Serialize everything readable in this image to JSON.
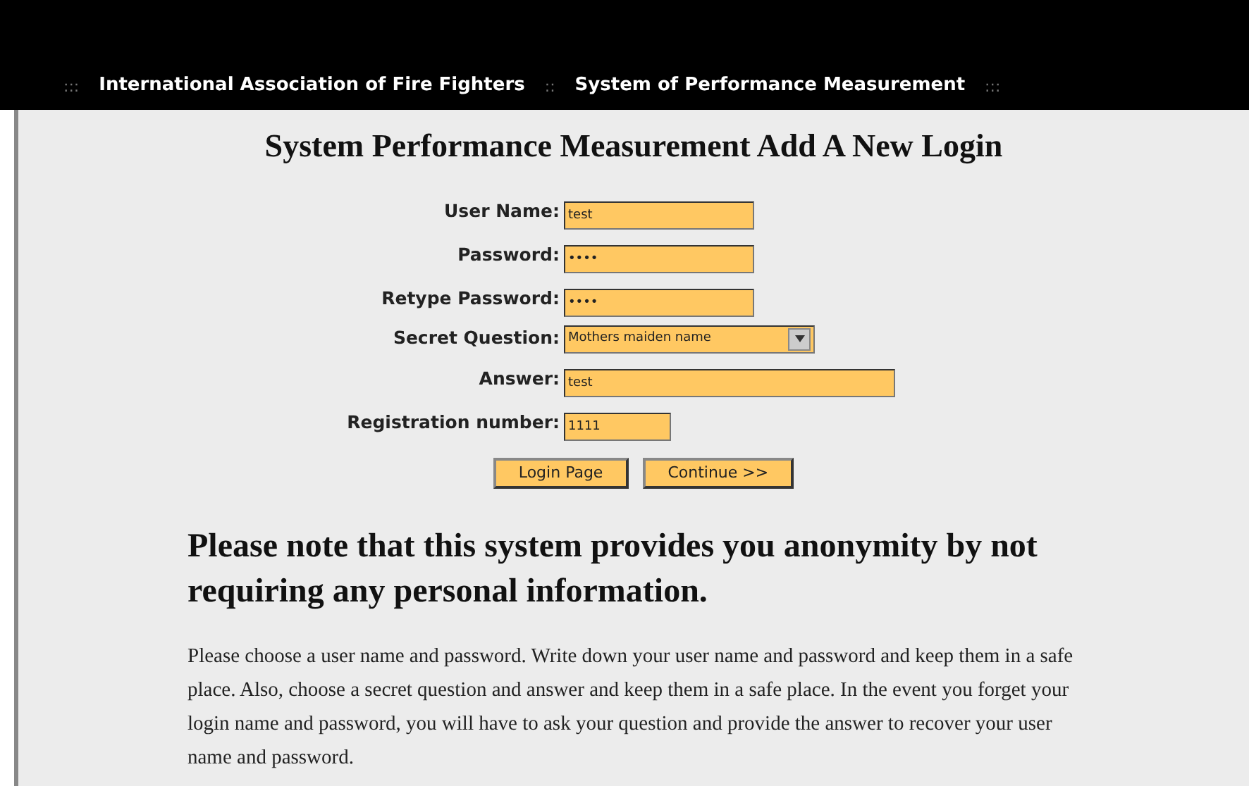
{
  "header": {
    "separators": [
      ":::",
      "::",
      ":::"
    ],
    "links": [
      "International Association of Fire Fighters",
      "System of Performance Measurement"
    ]
  },
  "title": "System Performance Measurement Add A New Login",
  "fields": [
    {
      "kind": "input",
      "label": "User Name:",
      "value": "test"
    },
    {
      "kind": "input",
      "label": "Password:",
      "value": "••••"
    },
    {
      "kind": "input",
      "label": "Retype Password:",
      "value": "••••"
    },
    {
      "kind": "select",
      "label": "Secret Question:",
      "value": "Mothers maiden name"
    },
    {
      "kind": "input",
      "label": "Answer:",
      "value": "test"
    },
    {
      "kind": "input",
      "label": "Registration number:",
      "value": "1111"
    }
  ],
  "buttons": [
    "Login Page",
    "Continue >>"
  ],
  "notice": "Please note that this system provides you anonymity by not requiring any personal information.",
  "instructions": "Please choose a user name and password. Write down your user name and password and keep them in a safe place. Also, choose a secret question and answer and keep them in a safe place. In the event you forget your login name and password, you will have to ask your question and provide the answer to recover your user name and password."
}
